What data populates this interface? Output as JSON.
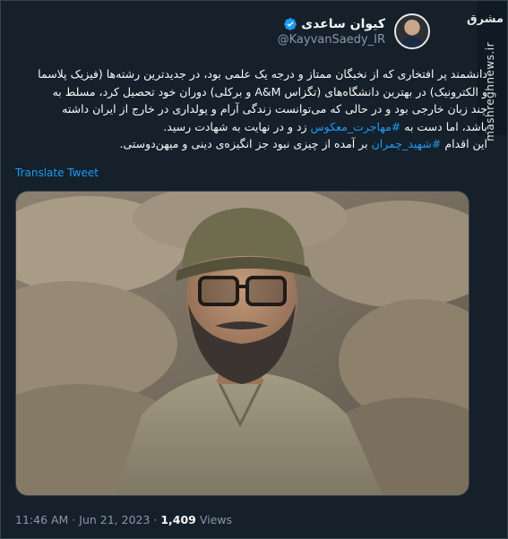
{
  "author": {
    "display_name": "کیوان ساعدی",
    "handle": "@KayvanSaedy_IR",
    "verified": true,
    "verified_color": "#1d9bf0"
  },
  "watermark": {
    "logo": "مشرق",
    "url": "mashreghnews.ir"
  },
  "tweet": {
    "line1": "دانشمند پر افتخاری که از نخبگان ممتاز و درجه یک علمی بود، در جدیدترین رشته‌ها (فیزیک پلاسما و الکترونیک) در بهترین دانشگاه‌های (تگزاس A&M و برکلی) دوران خود تحصیل کرد، مسلط به چند زبان خارجی بود و در حالی که می‌توانست زندگی آرام و پولداری در خارج از ایران داشته باشد، اما دست به",
    "hashtag1": "#مهاجرت_معکوس",
    "line2": " زد و در نهایت به شهادت رسید.",
    "line3_prefix": "این اقدام ",
    "hashtag2": "#شهید_چمران",
    "line3_suffix": " بر آمده از چیزی نبود جز انگیزه‌ی دینی و میهن‌دوستی."
  },
  "translate_label": "Translate Tweet",
  "footer": {
    "time_date": "11:46 AM · Jun 21, 2023 · ",
    "views_count": "1,409",
    "views_label": " Views"
  },
  "photo": {
    "icon": "portrait-photo"
  },
  "colors": {
    "background": "#15202b",
    "text": "#f7f9f9",
    "muted": "#8b98a5",
    "link": "#1d9bf0"
  }
}
